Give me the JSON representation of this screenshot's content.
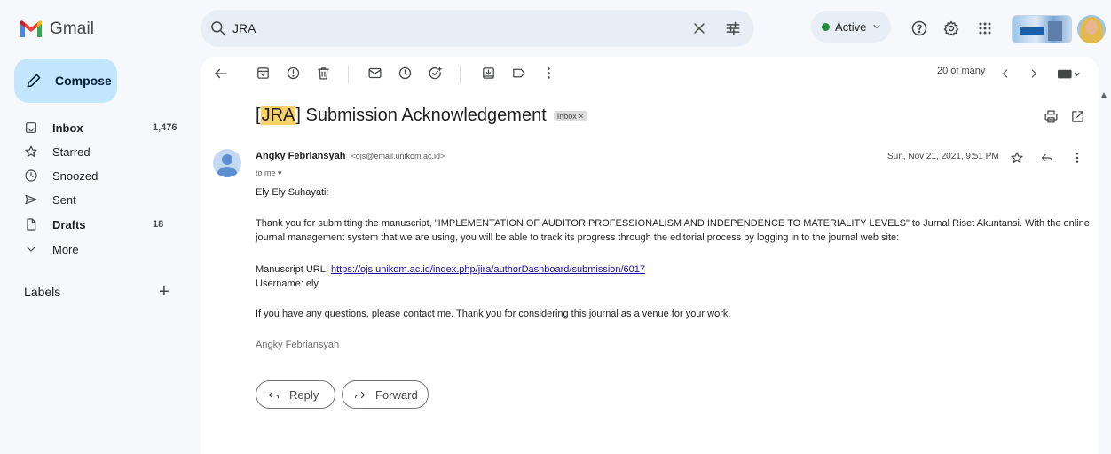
{
  "header": {
    "app_name": "Gmail",
    "search_value": "JRA",
    "status_label": "Active"
  },
  "sidebar": {
    "compose_label": "Compose",
    "items": [
      {
        "label": "Inbox",
        "count": "1,476",
        "icon": "inbox-icon"
      },
      {
        "label": "Starred",
        "count": "",
        "icon": "star-icon"
      },
      {
        "label": "Snoozed",
        "count": "",
        "icon": "clock-icon"
      },
      {
        "label": "Sent",
        "count": "",
        "icon": "send-icon"
      },
      {
        "label": "Drafts",
        "count": "18",
        "icon": "file-icon"
      },
      {
        "label": "More",
        "count": "",
        "icon": "chevron-down-icon"
      }
    ],
    "labels_title": "Labels"
  },
  "toolbar": {
    "pager_text": "20 of many"
  },
  "email": {
    "subject_highlight": "JRA",
    "subject_rest": "Submission Acknowledgement",
    "label_chip": "Inbox ×",
    "sender_name": "Angky Febriansyah",
    "sender_email": "<ojs@email.unikom.ac.id>",
    "recipient": "to me",
    "date": "Sun, Nov 21, 2021, 9:51 PM",
    "greeting": "Ely Ely Suhayati:",
    "paragraph1": "Thank you for submitting the manuscript, \"IMPLEMENTATION OF AUDITOR PROFESSIONALISM AND INDEPENDENCE TO MATERIALITY LEVELS\" to Jurnal Riset Akuntansi. With the online journal management system that we are using, you will be able to track its progress through the editorial process by logging in to the journal web site:",
    "manuscript_url_label": "Manuscript URL:",
    "manuscript_url": "https://ojs.unikom.ac.id/index.php/jira/authorDashboard/submission/6017",
    "username_line": "Username: ely",
    "paragraph2": "If you have any questions, please contact me. Thank you for considering this journal as a venue for your work.",
    "signature": "Angky Febriansyah",
    "reply_label": "Reply",
    "forward_label": "Forward"
  },
  "colors": {
    "accent": "#c2e7ff",
    "highlight": "#fad166",
    "status_green": "#1e8e3e",
    "link": "#1a0dab"
  }
}
